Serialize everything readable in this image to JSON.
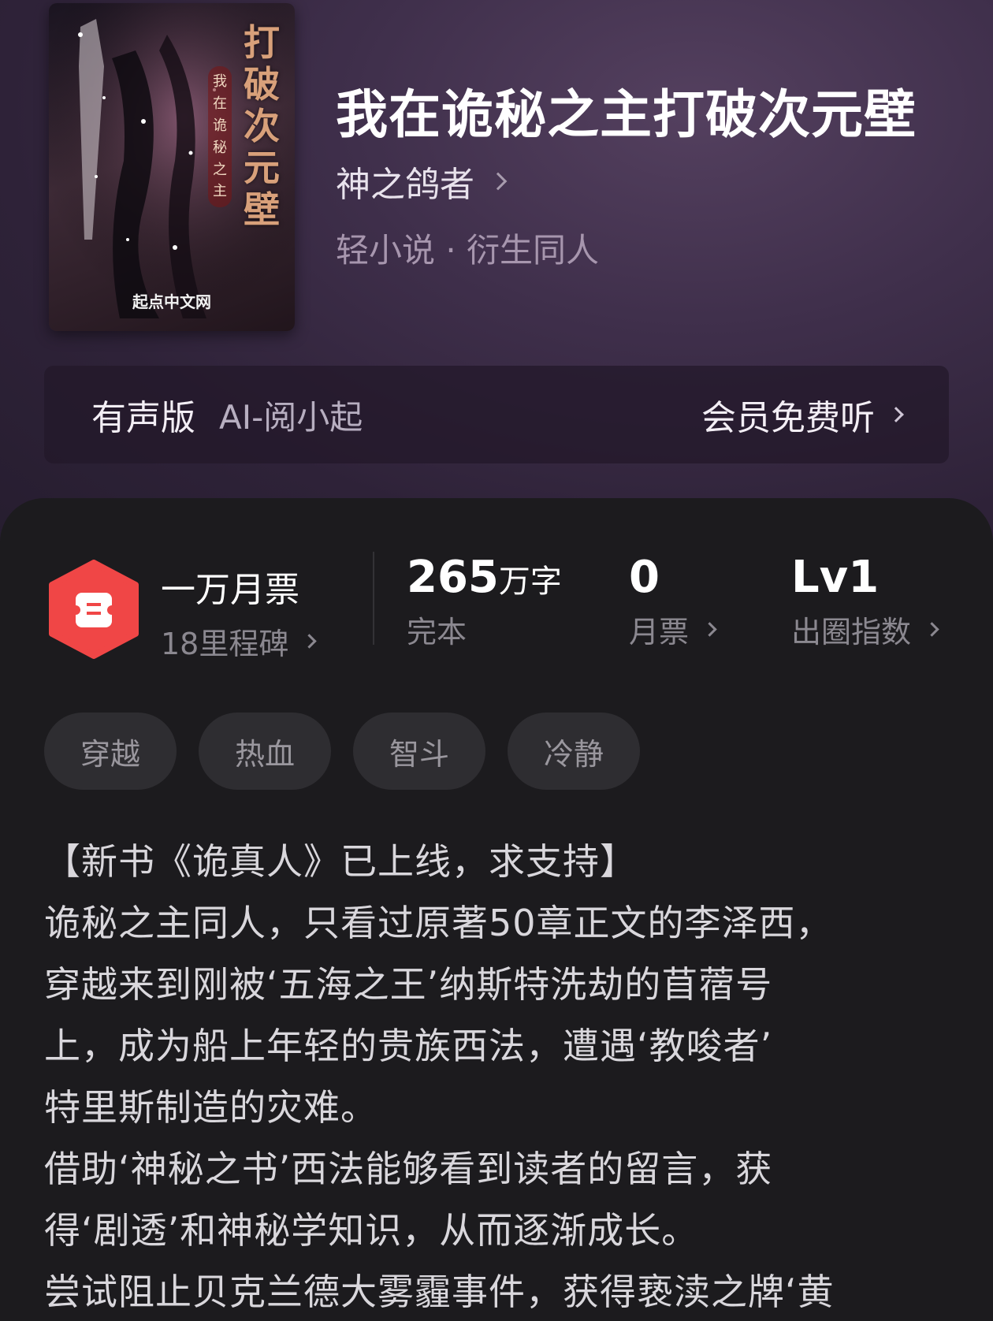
{
  "book": {
    "title": "我在诡秘之主打破次元壁",
    "author": "神之鸽者",
    "genre": "轻小说 · 衍生同人"
  },
  "cover": {
    "title_vertical": "打破次元壁",
    "subtitle_vertical": "我在诡秘之主",
    "publisher": "起点中文网"
  },
  "audio": {
    "label": "有声版",
    "ai_name": "AI-阅小起",
    "action": "会员免费听"
  },
  "stats": {
    "milestone": {
      "title": "一万月票",
      "sub": "18里程碑"
    },
    "words": {
      "value": "265",
      "unit": "万字",
      "sub": "完本"
    },
    "monthly_votes": {
      "value": "0",
      "sub": "月票"
    },
    "popularity": {
      "value": "Lv1",
      "sub": "出圈指数"
    }
  },
  "tags": [
    "穿越",
    "热血",
    "智斗",
    "冷静"
  ],
  "description": [
    "【新书《诡真人》已上线，求支持】",
    "诡秘之主同人，只看过原著50章正文的李泽西，",
    "穿越来到刚被‘五海之王’纳斯特洗劫的苜蓿号",
    "上，成为船上年轻的贵族西法，遭遇‘教唆者’",
    "特里斯制造的灾难。",
    "借助‘神秘之书’西法能够看到读者的留言，获",
    "得‘剧透’和神秘学知识，从而逐渐成长。",
    "尝试阻止贝克兰德大雾霾事件，获得亵渎之牌‘黄"
  ],
  "colors": {
    "hero_bg": "#3f2f4b",
    "panel_bg": "#1c1b1e",
    "badge_red": "#f04646",
    "tag_bg": "#2e2d31"
  }
}
